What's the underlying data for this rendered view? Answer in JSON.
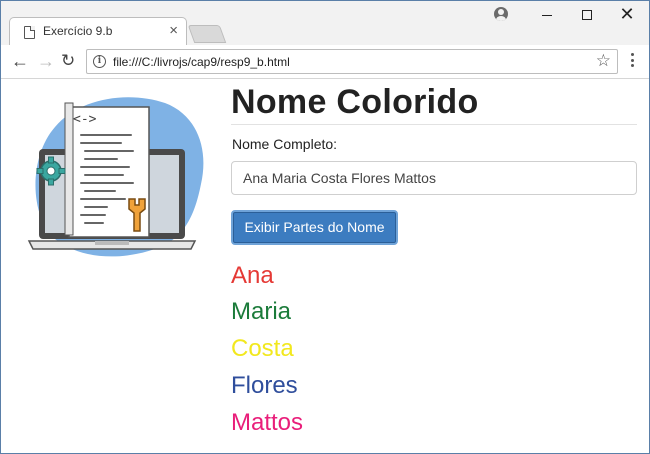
{
  "browser": {
    "tab_title": "Exercício 9.b",
    "tab_close": "×",
    "url": "file:///C:/livrojs/cap9/resp9_b.html",
    "icons": [
      "page-icon",
      "profile-icon",
      "back-arrow-icon",
      "forward-arrow-icon",
      "reload-icon",
      "info-icon",
      "star-icon",
      "menu-icon"
    ]
  },
  "window_controls": {
    "close_glyph": "✕"
  },
  "page": {
    "title": "Nome Colorido",
    "field_label": "Nome Completo:",
    "input_value": "Ana Maria Costa Flores Mattos",
    "button_label": "Exibir Partes do Nome",
    "name_parts": [
      {
        "text": "Ana",
        "color": "#e53935"
      },
      {
        "text": "Maria",
        "color": "#1b7b3a"
      },
      {
        "text": "Costa",
        "color": "#f2e81e"
      },
      {
        "text": "Flores",
        "color": "#2f4e9c"
      },
      {
        "text": "Mattos",
        "color": "#e91e7a"
      }
    ]
  }
}
